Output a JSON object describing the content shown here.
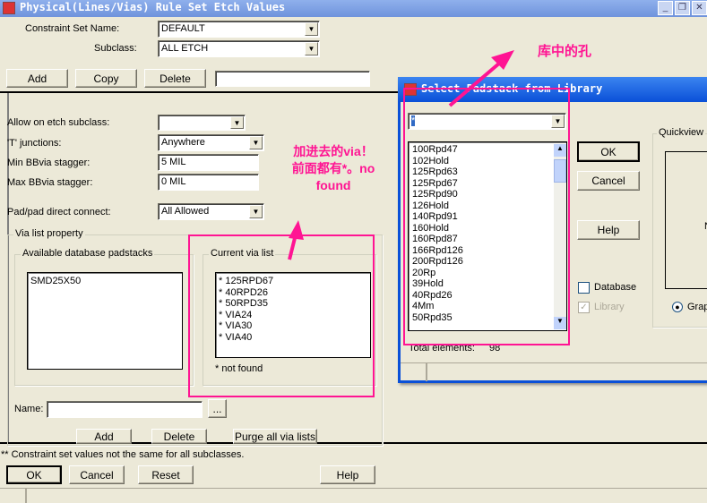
{
  "main": {
    "title": "Physical(Lines/Vias) Rule Set Etch Values",
    "window_buttons": [
      "_",
      "❐",
      "✕"
    ],
    "constraint_set_label": "Constraint Set Name:",
    "constraint_set_value": "DEFAULT",
    "subclass_label": "Subclass:",
    "subclass_value": "ALL ETCH",
    "add": "Add",
    "copy": "Copy",
    "delete": "Delete",
    "new_name_value": "",
    "allow_label": "Allow on etch subclass:",
    "allow_value": "",
    "t_label": "'T' junctions:",
    "t_value": "Anywhere",
    "min_label": "Min BBvia stagger:",
    "min_value": "5 MIL",
    "max_label": "Max BBvia stagger:",
    "max_value": "0 MIL",
    "pad_label": "Pad/pad direct connect:",
    "pad_value": "All Allowed",
    "via_group": "Via list property",
    "avail_group": "Available database padstacks",
    "avail_items": [
      "SMD25X50"
    ],
    "current_group": "Current via list",
    "current_items": [
      "* 125RPD67",
      "* 40RPD26",
      "* 50RPD35",
      "* VIA24",
      "* VIA30",
      "* VIA40"
    ],
    "not_found": "* not found",
    "name_label": "Name:",
    "name_value": "",
    "browse": "...",
    "via_add": "Add",
    "via_delete": "Delete",
    "purge": "Purge all via lists",
    "note": "** Constraint set values not the same for all subclasses.",
    "ok": "OK",
    "cancel": "Cancel",
    "reset": "Reset",
    "help": "Help"
  },
  "dialog": {
    "title": "Select Padstack from Library",
    "filter_value": "*",
    "items": [
      "100Rpd47",
      "102Hold",
      "125Rpd63",
      "125Rpd67",
      "125Rpd90",
      "126Hold",
      "140Rpd91",
      "160Hold",
      "160Rpd87",
      "166Rpd126",
      "200Rpd126",
      "20Rp",
      "39Hold",
      "40Rpd26",
      "4Mm",
      "50Rpd35"
    ],
    "ok": "OK",
    "cancel": "Cancel",
    "help": "Help",
    "database": "Database",
    "library": "Library",
    "quickview": "Quickview",
    "graphics": "Grap",
    "quick_n": "N",
    "total_label": "Total elements:",
    "total_value": "98"
  },
  "annotations": {
    "library_holes": "库中的孔",
    "added_vias": "加进去的via！",
    "added_vias2": "前面都有*。no",
    "added_vias3": "found"
  },
  "colors": {
    "annotation": "#ff1493"
  }
}
